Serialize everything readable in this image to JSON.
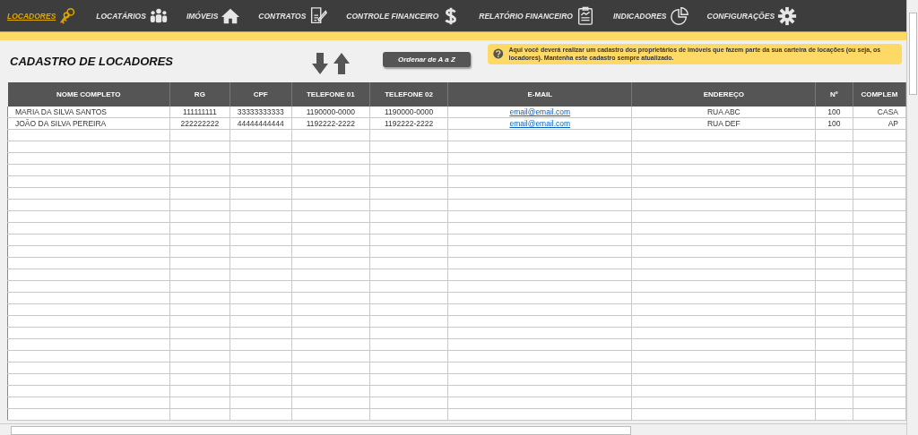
{
  "nav": [
    {
      "label": "LOCADORES",
      "selected": true
    },
    {
      "label": "LOCATÁRIOS",
      "selected": false
    },
    {
      "label": "IMÓVEIS",
      "selected": false
    },
    {
      "label": "CONTRATOS",
      "selected": false
    },
    {
      "label": "CONTROLE FINANCEIRO",
      "selected": false
    },
    {
      "label": "RELATÓRIO FINANCEIRO",
      "selected": false
    },
    {
      "label": "INDICADORES",
      "selected": false
    },
    {
      "label": "CONFIGURAÇÕES",
      "selected": false
    }
  ],
  "title": "CADASTRO DE LOCADORES",
  "sort_button": "Ordenar de A a Z",
  "help_note": "Aqui você deverá realizar um cadastro dos proprietários de imóveis que fazem parte da sua carteira de locações (ou seja, os locadores). Mantenha este cadastro sempre atualizado.",
  "table": {
    "columns": [
      {
        "label": "NOME COMPLETO",
        "kind": "text"
      },
      {
        "label": "RG",
        "kind": "text"
      },
      {
        "label": "CPF",
        "kind": "text"
      },
      {
        "label": "TELEFONE 01",
        "kind": "text"
      },
      {
        "label": "TELEFONE 02",
        "kind": "text"
      },
      {
        "label": "E-MAIL",
        "kind": "email"
      },
      {
        "label": "ENDEREÇO",
        "kind": "text"
      },
      {
        "label": "Nº",
        "kind": "text"
      },
      {
        "label": "COMPLEM",
        "kind": "text"
      }
    ],
    "rows": [
      [
        "MARIA DA SILVA SANTOS",
        "111111111",
        "33333333333",
        "1190000-0000",
        "1190000-0000",
        "email@email.com",
        "RUA ABC",
        "100",
        "CASA"
      ],
      [
        "JOÃO DA SILVA PEREIRA",
        "222222222",
        "44444444444",
        "1192222-2222",
        "1192222-2222",
        "email@email.com",
        "RUA DEF",
        "100",
        "AP"
      ]
    ]
  }
}
